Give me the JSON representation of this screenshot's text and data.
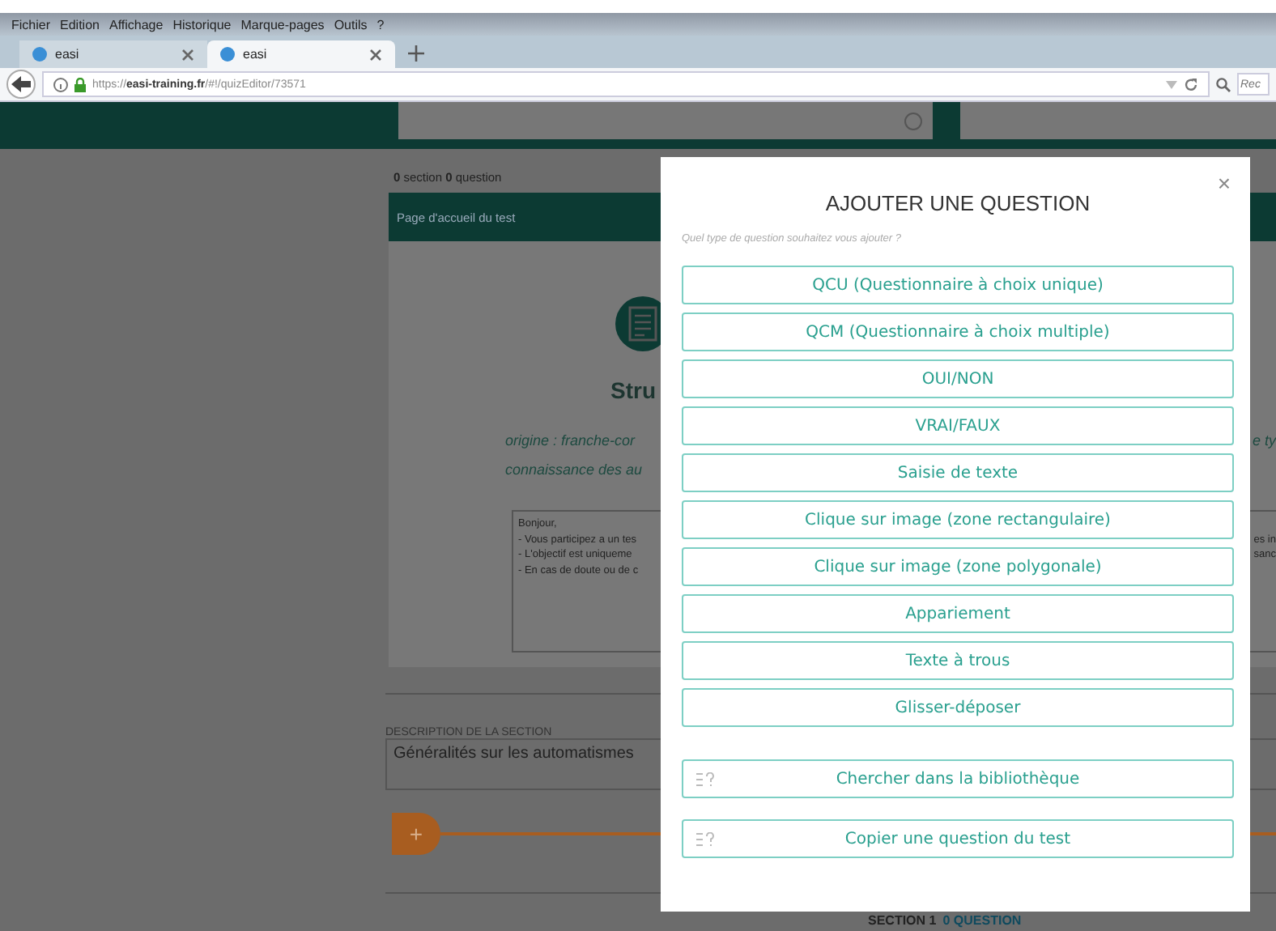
{
  "browser": {
    "menu": [
      "Fichier",
      "Edition",
      "Affichage",
      "Historique",
      "Marque-pages",
      "Outils",
      "?"
    ],
    "tabs": [
      {
        "title": "easi",
        "selected": false
      },
      {
        "title": "easi",
        "selected": true
      }
    ],
    "url_prefix": "https://",
    "url_domain": "easi-training.fr",
    "url_path": "/#!/quizEditor/73571",
    "search_placeholder": "Rec"
  },
  "page": {
    "stats": "**0** section **0** question",
    "welcome_bar": "Page d'accueil du test",
    "title_fragment": "Stru",
    "subtitle_lines": [
      {
        "left": "origine : franche-cor",
        "right": "e ty"
      },
      {
        "left": "connaissance des au"
      }
    ],
    "message_lines": [
      {
        "left": "Bonjour,"
      },
      {
        "left": "- Vous participez a un tes",
        "right": "es in"
      },
      {
        "left": "- L'objectif est uniqueme",
        "right": "sanc"
      },
      {
        "left": "- En cas de doute ou de c"
      }
    ],
    "section_description_label": "DESCRIPTION DE LA SECTION",
    "section_description": "Généralités sur les automatismes",
    "add_symbol": "+",
    "section_heading": "SECTION 1",
    "section_count": "0 QUESTION"
  },
  "modal": {
    "title": "AJOUTER UNE QUESTION",
    "close": "×",
    "prompt": "Quel type de question souhaitez vous ajouter ?",
    "options": [
      {
        "kind": "type",
        "label": "QCU (Questionnaire à choix unique)"
      },
      {
        "kind": "type",
        "label": "QCM (Questionnaire à choix multiple)"
      },
      {
        "kind": "type",
        "label": "OUI/NON"
      },
      {
        "kind": "type",
        "label": "VRAI/FAUX"
      },
      {
        "kind": "type",
        "label": "Saisie de texte"
      },
      {
        "kind": "type",
        "label": "Clique sur image (zone rectangulaire)"
      },
      {
        "kind": "type",
        "label": "Clique sur image (zone polygonale)"
      },
      {
        "kind": "type",
        "label": "Appariement"
      },
      {
        "kind": "type",
        "label": "Texte à trous"
      },
      {
        "kind": "type",
        "label": "Glisser-déposer"
      },
      {
        "kind": "tool",
        "label": "Chercher dans la bibliothèque"
      },
      {
        "kind": "tool",
        "label": "Copier une question du test"
      }
    ]
  }
}
